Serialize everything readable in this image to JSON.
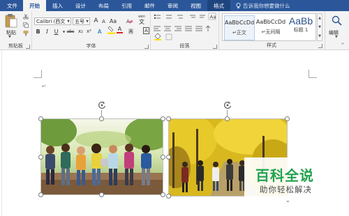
{
  "tabs": [
    {
      "label": "文件",
      "name": "tab-file"
    },
    {
      "label": "开始",
      "name": "tab-home"
    },
    {
      "label": "插入",
      "name": "tab-insert"
    },
    {
      "label": "设计",
      "name": "tab-design"
    },
    {
      "label": "布局",
      "name": "tab-layout"
    },
    {
      "label": "引用",
      "name": "tab-references"
    },
    {
      "label": "邮件",
      "name": "tab-mailings"
    },
    {
      "label": "审阅",
      "name": "tab-review"
    },
    {
      "label": "视图",
      "name": "tab-view"
    },
    {
      "label": "格式",
      "name": "tab-format"
    }
  ],
  "active_tab": "开始",
  "tell_me": "告诉我你想要做什么",
  "ribbon": {
    "clipboard": {
      "label": "剪贴板",
      "paste_label": "粘贴"
    },
    "font": {
      "label": "字体",
      "font_name": "Calibri (西文",
      "font_size": "五号",
      "grow": "A",
      "shrink": "A",
      "aa": "Aa",
      "wen": "wén",
      "wen_label": "文",
      "bold": "B",
      "italic": "I",
      "underline": "U",
      "strike": "abc",
      "sub": "x₂",
      "sup": "x²",
      "color_a": "A",
      "highlight": "A",
      "char_shade": "A",
      "char_border": "A"
    },
    "paragraph": {
      "label": "段落"
    },
    "styles": {
      "label": "样式",
      "items": [
        {
          "sample": "AaBbCcDd",
          "name": "↵正文"
        },
        {
          "sample": "AaBbCcDd",
          "name": "↵无间隔"
        },
        {
          "sample": "AaBb",
          "name": "标题 1"
        }
      ]
    },
    "editing": {
      "label": "编辑"
    }
  },
  "document": {
    "paragraph_mark": "↵"
  },
  "watermark": {
    "title": "百科全说",
    "subtitle": "助你轻松解决"
  },
  "colors": {
    "titlebar": "#2b579a",
    "ribbon_bg": "#f3f3f3",
    "watermark_green": "#22a24f",
    "font_color_red": "#e02020",
    "highlight_yellow": "#ffe400"
  }
}
